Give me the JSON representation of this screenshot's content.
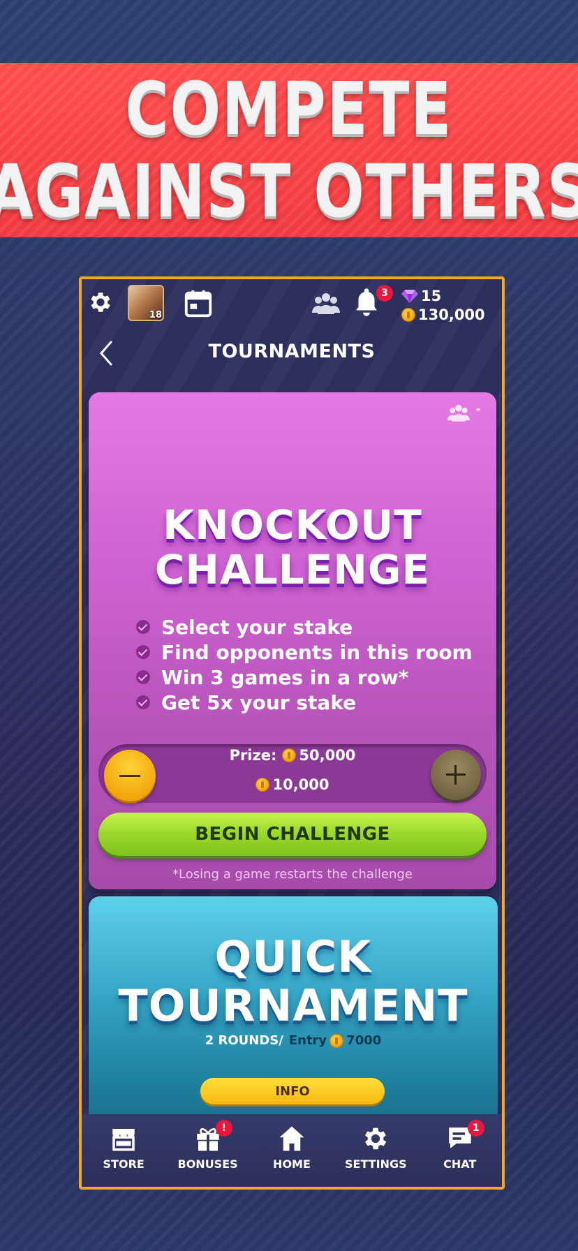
{
  "banner": {
    "line1": "COMPETE",
    "line2": "AGAINST OTHERS"
  },
  "topbar": {
    "avatar_level": "18",
    "notifications_count": "3",
    "gems": "15",
    "coins": "130,000"
  },
  "header": {
    "title": "TOURNAMENTS"
  },
  "knockout": {
    "players_count": "-",
    "title_line1": "KNOCKOUT",
    "title_line2": "CHALLENGE",
    "steps": [
      "Select your stake",
      "Find opponents in this room",
      "Win 3 games in a row*",
      "Get 5x your stake"
    ],
    "prize_label": "Prize:",
    "prize_value": "50,000",
    "stake_value": "10,000",
    "begin_label": "BEGIN CHALLENGE",
    "note": "*Losing a game restarts the challenge"
  },
  "quick": {
    "title_line1": "QUICK",
    "title_line2": "TOURNAMENT",
    "rounds": "2 ROUNDS/",
    "entry_label": "Entry",
    "entry_value": "7000",
    "info_label": "INFO"
  },
  "nav": {
    "items": [
      {
        "label": "STORE",
        "icon": "store-icon",
        "badge": ""
      },
      {
        "label": "BONUSES",
        "icon": "gift-icon",
        "badge": "!"
      },
      {
        "label": "HOME",
        "icon": "home-icon",
        "badge": ""
      },
      {
        "label": "SETTINGS",
        "icon": "gear-icon",
        "badge": ""
      },
      {
        "label": "CHAT",
        "icon": "chat-icon",
        "badge": "1"
      }
    ]
  },
  "colors": {
    "accent_border": "#f4a81e",
    "banner_red": "#f03a3f",
    "knockout_purple": "#cf62d2",
    "begin_green": "#9ad82a",
    "quick_blue": "#38a9c9",
    "badge_red": "#e8173d"
  }
}
